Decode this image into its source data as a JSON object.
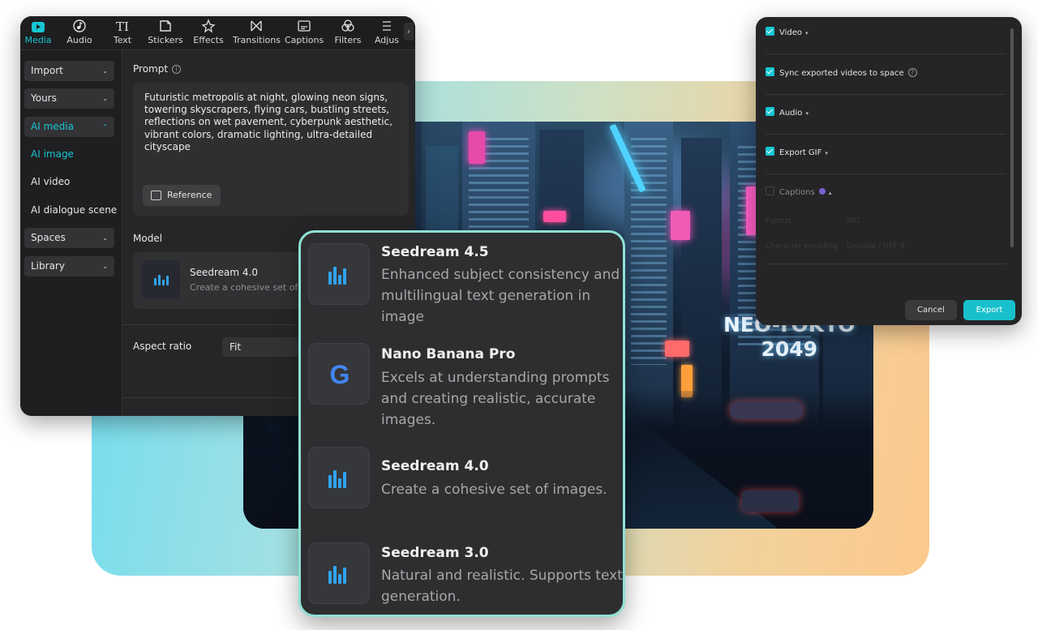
{
  "toolbar": {
    "items": [
      {
        "label": "Media",
        "icon": "media-icon"
      },
      {
        "label": "Audio",
        "icon": "audio-icon"
      },
      {
        "label": "Text",
        "icon": "text-icon"
      },
      {
        "label": "Stickers",
        "icon": "stickers-icon"
      },
      {
        "label": "Effects",
        "icon": "effects-icon"
      },
      {
        "label": "Transitions",
        "icon": "transitions-icon"
      },
      {
        "label": "Captions",
        "icon": "captions-icon"
      },
      {
        "label": "Filters",
        "icon": "filters-icon"
      },
      {
        "label": "Adjus",
        "icon": "adjust-icon"
      }
    ],
    "text_glyph": "TI",
    "more_glyph": "›"
  },
  "sidebar": {
    "items": [
      {
        "label": "Import"
      },
      {
        "label": "Yours"
      },
      {
        "label": "AI media"
      },
      {
        "label": "AI image"
      },
      {
        "label": "AI video"
      },
      {
        "label": "AI dialogue scene"
      },
      {
        "label": "Spaces"
      },
      {
        "label": "Library"
      }
    ],
    "chevron_down": "⌄",
    "chevron_up": "⌃"
  },
  "prompt": {
    "label": "Prompt",
    "info": "i",
    "text": "Futuristic metropolis at night, glowing neon signs, towering skyscrapers, flying cars, bustling streets, reflections on wet pavement, cyberpunk aesthetic, vibrant colors, dramatic lighting, ultra-detailed cityscape",
    "reference_button": "Reference"
  },
  "model": {
    "label": "Model",
    "name": "Seedream 4.0",
    "description": "Create a cohesive set of i"
  },
  "aspect": {
    "label": "Aspect ratio",
    "value": "Fit"
  },
  "scene": {
    "sign_text": "NEO-TOKYO\n2049"
  },
  "dropdown": {
    "items": [
      {
        "name": "Seedream 4.5",
        "description": "Enhanced subject consistency and multilingual text generation in image",
        "icon": "seedream-icon"
      },
      {
        "name": "Nano Banana Pro",
        "description": "Excels at understanding prompts and creating realistic, accurate images.",
        "icon": "google-icon"
      },
      {
        "name": "Seedream 4.0",
        "description": "Create a cohesive set of images.",
        "icon": "seedream-icon"
      },
      {
        "name": "Seedream 3.0",
        "description": "Natural and realistic. Supports text generation.",
        "icon": "seedream-icon"
      }
    ],
    "google_glyph": "G"
  },
  "export_panel": {
    "rows": [
      {
        "label": "Video",
        "checked": true,
        "caret": "▾"
      },
      {
        "label": "Sync exported videos to space",
        "checked": true,
        "info": "?"
      },
      {
        "label": "Audio",
        "checked": true,
        "caret": "▾"
      },
      {
        "label": "Export GIF",
        "checked": true,
        "caret": "▾"
      },
      {
        "label": "Captions",
        "checked": false,
        "caret": "▴"
      }
    ],
    "ghost_rows": [
      "Format",
      "SRT",
      "Character encoding",
      "Unicode / UTF-8"
    ],
    "cancel": "Cancel",
    "export": "Export"
  },
  "colors": {
    "accent": "#17c6d2",
    "panel": "#262628",
    "dropdown_border": "#8fe0d4",
    "export_button": "#18c0cc",
    "seedream_icon": "#2fa3f0",
    "google_blue": "#4285f4"
  }
}
